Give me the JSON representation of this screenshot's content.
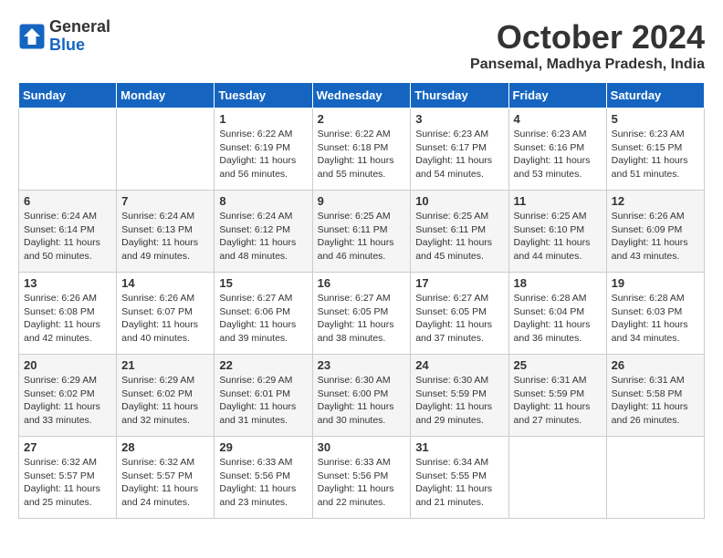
{
  "header": {
    "logo_line1": "General",
    "logo_line2": "Blue",
    "month": "October 2024",
    "location": "Pansemal, Madhya Pradesh, India"
  },
  "weekdays": [
    "Sunday",
    "Monday",
    "Tuesday",
    "Wednesday",
    "Thursday",
    "Friday",
    "Saturday"
  ],
  "weeks": [
    [
      {
        "day": "",
        "text": ""
      },
      {
        "day": "",
        "text": ""
      },
      {
        "day": "1",
        "text": "Sunrise: 6:22 AM\nSunset: 6:19 PM\nDaylight: 11 hours\nand 56 minutes."
      },
      {
        "day": "2",
        "text": "Sunrise: 6:22 AM\nSunset: 6:18 PM\nDaylight: 11 hours\nand 55 minutes."
      },
      {
        "day": "3",
        "text": "Sunrise: 6:23 AM\nSunset: 6:17 PM\nDaylight: 11 hours\nand 54 minutes."
      },
      {
        "day": "4",
        "text": "Sunrise: 6:23 AM\nSunset: 6:16 PM\nDaylight: 11 hours\nand 53 minutes."
      },
      {
        "day": "5",
        "text": "Sunrise: 6:23 AM\nSunset: 6:15 PM\nDaylight: 11 hours\nand 51 minutes."
      }
    ],
    [
      {
        "day": "6",
        "text": "Sunrise: 6:24 AM\nSunset: 6:14 PM\nDaylight: 11 hours\nand 50 minutes."
      },
      {
        "day": "7",
        "text": "Sunrise: 6:24 AM\nSunset: 6:13 PM\nDaylight: 11 hours\nand 49 minutes."
      },
      {
        "day": "8",
        "text": "Sunrise: 6:24 AM\nSunset: 6:12 PM\nDaylight: 11 hours\nand 48 minutes."
      },
      {
        "day": "9",
        "text": "Sunrise: 6:25 AM\nSunset: 6:11 PM\nDaylight: 11 hours\nand 46 minutes."
      },
      {
        "day": "10",
        "text": "Sunrise: 6:25 AM\nSunset: 6:11 PM\nDaylight: 11 hours\nand 45 minutes."
      },
      {
        "day": "11",
        "text": "Sunrise: 6:25 AM\nSunset: 6:10 PM\nDaylight: 11 hours\nand 44 minutes."
      },
      {
        "day": "12",
        "text": "Sunrise: 6:26 AM\nSunset: 6:09 PM\nDaylight: 11 hours\nand 43 minutes."
      }
    ],
    [
      {
        "day": "13",
        "text": "Sunrise: 6:26 AM\nSunset: 6:08 PM\nDaylight: 11 hours\nand 42 minutes."
      },
      {
        "day": "14",
        "text": "Sunrise: 6:26 AM\nSunset: 6:07 PM\nDaylight: 11 hours\nand 40 minutes."
      },
      {
        "day": "15",
        "text": "Sunrise: 6:27 AM\nSunset: 6:06 PM\nDaylight: 11 hours\nand 39 minutes."
      },
      {
        "day": "16",
        "text": "Sunrise: 6:27 AM\nSunset: 6:05 PM\nDaylight: 11 hours\nand 38 minutes."
      },
      {
        "day": "17",
        "text": "Sunrise: 6:27 AM\nSunset: 6:05 PM\nDaylight: 11 hours\nand 37 minutes."
      },
      {
        "day": "18",
        "text": "Sunrise: 6:28 AM\nSunset: 6:04 PM\nDaylight: 11 hours\nand 36 minutes."
      },
      {
        "day": "19",
        "text": "Sunrise: 6:28 AM\nSunset: 6:03 PM\nDaylight: 11 hours\nand 34 minutes."
      }
    ],
    [
      {
        "day": "20",
        "text": "Sunrise: 6:29 AM\nSunset: 6:02 PM\nDaylight: 11 hours\nand 33 minutes."
      },
      {
        "day": "21",
        "text": "Sunrise: 6:29 AM\nSunset: 6:02 PM\nDaylight: 11 hours\nand 32 minutes."
      },
      {
        "day": "22",
        "text": "Sunrise: 6:29 AM\nSunset: 6:01 PM\nDaylight: 11 hours\nand 31 minutes."
      },
      {
        "day": "23",
        "text": "Sunrise: 6:30 AM\nSunset: 6:00 PM\nDaylight: 11 hours\nand 30 minutes."
      },
      {
        "day": "24",
        "text": "Sunrise: 6:30 AM\nSunset: 5:59 PM\nDaylight: 11 hours\nand 29 minutes."
      },
      {
        "day": "25",
        "text": "Sunrise: 6:31 AM\nSunset: 5:59 PM\nDaylight: 11 hours\nand 27 minutes."
      },
      {
        "day": "26",
        "text": "Sunrise: 6:31 AM\nSunset: 5:58 PM\nDaylight: 11 hours\nand 26 minutes."
      }
    ],
    [
      {
        "day": "27",
        "text": "Sunrise: 6:32 AM\nSunset: 5:57 PM\nDaylight: 11 hours\nand 25 minutes."
      },
      {
        "day": "28",
        "text": "Sunrise: 6:32 AM\nSunset: 5:57 PM\nDaylight: 11 hours\nand 24 minutes."
      },
      {
        "day": "29",
        "text": "Sunrise: 6:33 AM\nSunset: 5:56 PM\nDaylight: 11 hours\nand 23 minutes."
      },
      {
        "day": "30",
        "text": "Sunrise: 6:33 AM\nSunset: 5:56 PM\nDaylight: 11 hours\nand 22 minutes."
      },
      {
        "day": "31",
        "text": "Sunrise: 6:34 AM\nSunset: 5:55 PM\nDaylight: 11 hours\nand 21 minutes."
      },
      {
        "day": "",
        "text": ""
      },
      {
        "day": "",
        "text": ""
      }
    ]
  ]
}
